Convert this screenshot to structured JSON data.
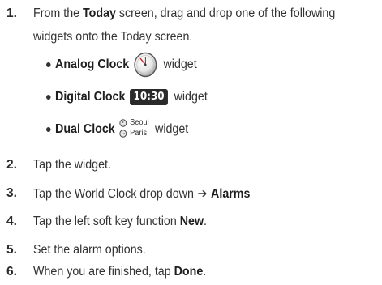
{
  "steps": [
    {
      "num": "1.",
      "line1_prefix": "From the ",
      "line1_bold": "Today",
      "line1_suffix": " screen, drag and drop one of the following",
      "line2": "widgets onto the Today screen.",
      "widgets": [
        {
          "name": "Analog Clock",
          "suffix": "widget",
          "icon": "analog-clock-icon"
        },
        {
          "name": "Digital Clock",
          "icon_text": "10:30",
          "suffix": "widget",
          "icon": "digital-clock-icon"
        },
        {
          "name": "Dual Clock",
          "city1": "Seoul",
          "city2": "Paris",
          "suffix": "widget",
          "icon": "dual-clock-icon"
        }
      ]
    },
    {
      "num": "2.",
      "text": "Tap the widget."
    },
    {
      "num": "3.",
      "prefix": "Tap the World Clock drop down",
      "arrow": "➔",
      "bold": "Alarms"
    },
    {
      "num": "4.",
      "prefix": "Tap the left soft key function ",
      "bold": "New",
      "suffix": "."
    },
    {
      "num": "5.",
      "text": "Set the alarm options."
    },
    {
      "num": "6.",
      "prefix": "When you are finished, tap ",
      "bold": "Done",
      "suffix": "."
    }
  ],
  "colors": {
    "text": "#333333",
    "icon_dark": "#2a2a2a",
    "clock_hand": "#d23030"
  }
}
